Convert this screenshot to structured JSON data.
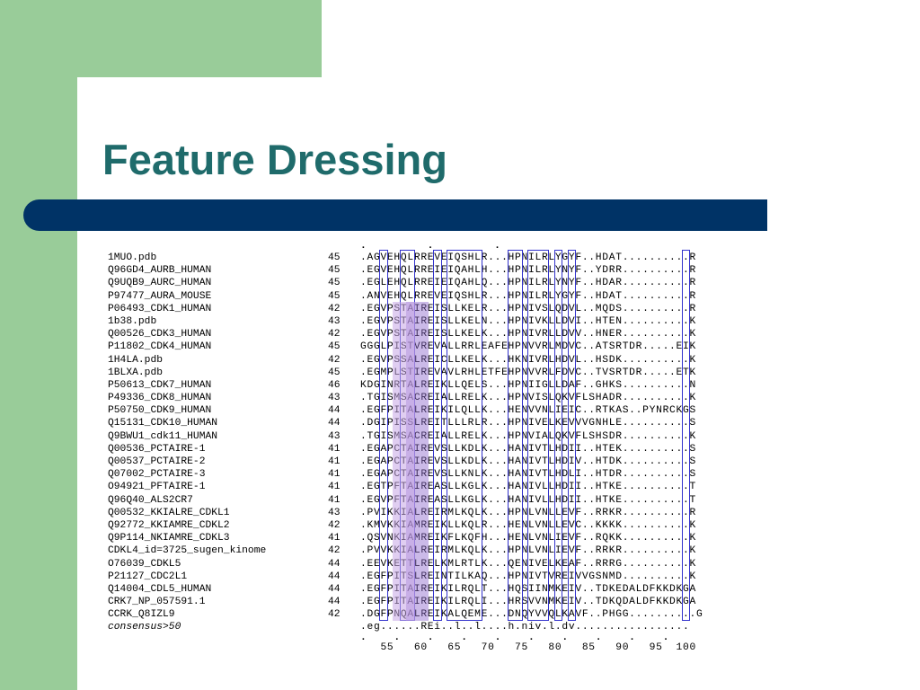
{
  "title": "Feature Dressing",
  "top_marks": ".          .          .",
  "rows": [
    {
      "name": "1MUO.pdb",
      "pos": "45",
      "seq": ".AGVEHQLRREVEIQSHLR...HPNILRLYGYF..HDAT..........R"
    },
    {
      "name": "Q96GD4_AURB_HUMAN",
      "pos": "45",
      "seq": ".EGVEHQLRREIEIQAHLH...HPNILRLYNYF..YDRR..........R"
    },
    {
      "name": "Q9UQB9_AURC_HUMAN",
      "pos": "45",
      "seq": ".EGLEHQLRREIEIQAHLQ...HPNILRLYNYF..HDAR..........R"
    },
    {
      "name": "P97477_AURA_MOUSE",
      "pos": "45",
      "seq": ".ANVEHQLRREVEIQSHLR...HPNILRLYGYF..HDAT..........R"
    },
    {
      "name": "P06493_CDK1_HUMAN",
      "pos": "42",
      "seq": ".EGVPSTAIREISLLKELR...HPNIVSLQDVL..MQDS..........R"
    },
    {
      "name": "1b38.pdb",
      "pos": "43",
      "seq": ".EGVPSTAIREISLLKELN...HPNIVKLLDVI..HTEN..........K"
    },
    {
      "name": "Q00526_CDK3_HUMAN",
      "pos": "42",
      "seq": ".EGVPSTAIREISLLKELK...HPNIVRLLDVV..HNER..........K"
    },
    {
      "name": "P11802_CDK4_HUMAN",
      "pos": "45",
      "seq": "GGGLPISTVREVALLRRLEAFEHPNVVRLMDVC..ATSRTDR.....EIK"
    },
    {
      "name": "1H4LA.pdb",
      "pos": "42",
      "seq": ".EGVPSSALREICLLKELK...HKNIVRLHDVL..HSDK..........K"
    },
    {
      "name": "1BLXA.pdb",
      "pos": "45",
      "seq": ".EGMPLSTIREVAVLRHLETFEHPNVVRLFDVC..TVSRTDR.....ETK"
    },
    {
      "name": "P50613_CDK7_HUMAN",
      "pos": "46",
      "seq": "KDGINRTALREIKLLQELS...HPNIIGLLDAF..GHKS..........N"
    },
    {
      "name": "P49336_CDK8_HUMAN",
      "pos": "43",
      "seq": ".TGISMSACREIALLRELK...HPNVISLQKVFLSHADR..........K"
    },
    {
      "name": "P50750_CDK9_HUMAN",
      "pos": "44",
      "seq": ".EGFPITALREIKILQLLK...HENVVNLIEIC..RTKAS..PYNRCKGS"
    },
    {
      "name": "Q15131_CDK10_HUMAN",
      "pos": "44",
      "seq": ".DGIPISSLREITLLLRLR...HPNIVELKEVVVGNHLE..........S"
    },
    {
      "name": "Q9BWU1_cdk11_HUMAN",
      "pos": "43",
      "seq": ".TGISMSACREIALLRELK...HPNVIALQKVFLSHSDR..........K"
    },
    {
      "name": "Q00536_PCTAIRE-1",
      "pos": "41",
      "seq": ".EGAPCTAIREVSLLKDLK...HANIVTLHDII..HTEK..........S"
    },
    {
      "name": "Q00537_PCTAIRE-2",
      "pos": "41",
      "seq": ".EGAPCTAIREVSLLKDLK...HANIVTLHDIV..HTDK..........S"
    },
    {
      "name": "Q07002_PCTAIRE-3",
      "pos": "41",
      "seq": ".EGAPCTAIREVSLLKNLK...HANIVTLHDLI..HTDR..........S"
    },
    {
      "name": "O94921_PFTAIRE-1",
      "pos": "41",
      "seq": ".EGTPFTAIREASLLKGLK...HANIVLLHDII..HTKE..........T"
    },
    {
      "name": "Q96Q40_ALS2CR7",
      "pos": "41",
      "seq": ".EGVPFTAIREASLLKGLK...HANIVLLHDII..HTKE..........T"
    },
    {
      "name": "Q00532_KKIALRE_CDKL1",
      "pos": "43",
      "seq": ".PVIKKIALREIRMLKQLK...HPNLVNLLEVF..RRKR..........R"
    },
    {
      "name": "Q92772_KKIAMRE_CDKL2",
      "pos": "42",
      "seq": ".KMVKKIAMREIKLLKQLR...HENLVNLLEVC..KKKK..........K"
    },
    {
      "name": "Q9P114_NKIAMRE_CDKL3",
      "pos": "41",
      "seq": ".QSVNKIAMREIKFLKQFH...HENLVNLIEVF..RQKK..........K"
    },
    {
      "name": "CDKL4_id=3725_sugen_kinome",
      "pos": "42",
      "seq": ".PVVKKIALREIRMLKQLK...HPNLVNLIEVF..RRKR..........K"
    },
    {
      "name": "O76039_CDKL5",
      "pos": "44",
      "seq": ".EEVKETTLRELKMLRTLK...QENIVELKEAF..RRRG..........K"
    },
    {
      "name": "P21127_CDC2L1",
      "pos": "44",
      "seq": ".EGFPITSLREINTILKAQ...HPNIVTVREIVVGSNMD..........K"
    },
    {
      "name": "Q14004_CDL5_HUMAN",
      "pos": "44",
      "seq": ".EGFPITAIREIKILRQLT...HQSIINMKEIV..TDKEDALDFKKDKGA"
    },
    {
      "name": "CRK7_NP_057591.1",
      "pos": "44",
      "seq": ".EGFPITAIREIKILRQLI...HRSVVNMKEIV..TDKQDALDFKKDKGA"
    },
    {
      "name": "CCRK_Q8IZL9",
      "pos": "42",
      "seq": ".DGFPNQALREIKALQEME...DNQYVVQLKAVF..PHGG..........G"
    }
  ],
  "consensus": {
    "name": "consensus>50",
    "seq": ".eg......REi..l..l....h.niv.l.dv................."
  },
  "ruler_ticks": ".    .    .    .    .    .    .    .    .    .",
  "ruler": "   55   60   65   70   75   80   85   90   95  100"
}
